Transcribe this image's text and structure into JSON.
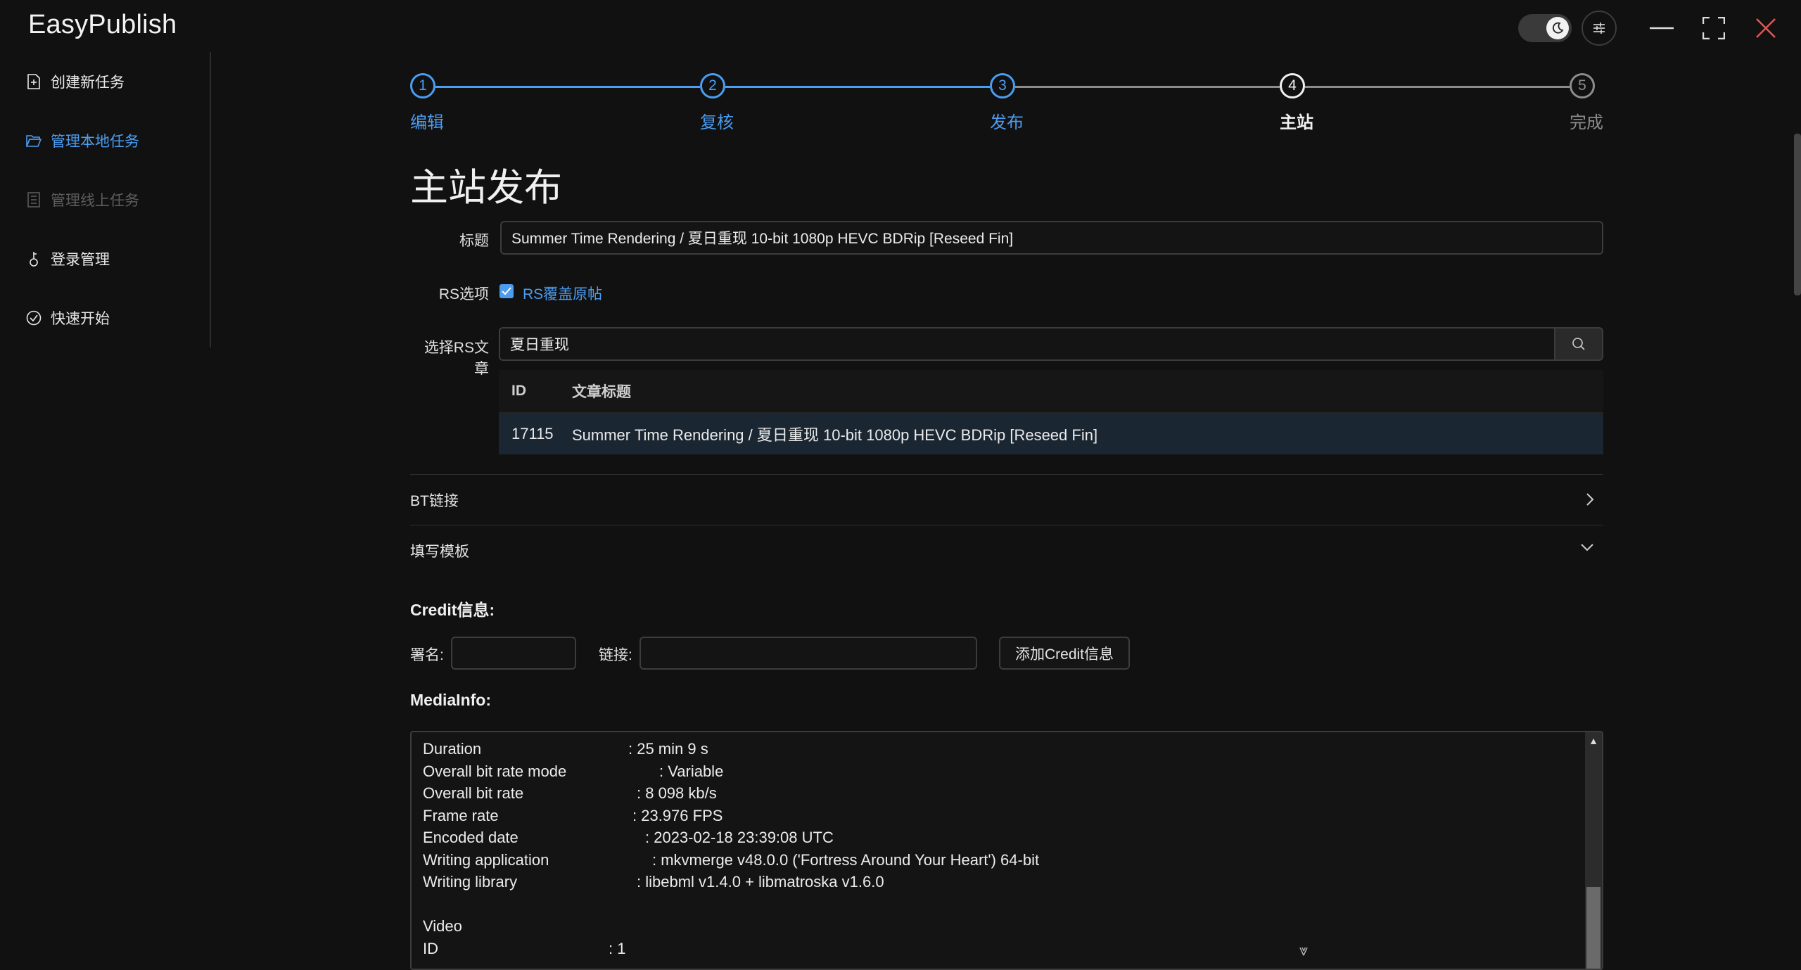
{
  "app": {
    "title": "EasyPublish"
  },
  "sidebar": {
    "items": [
      {
        "label": "创建新任务"
      },
      {
        "label": "管理本地任务"
      },
      {
        "label": "管理线上任务"
      },
      {
        "label": "登录管理"
      },
      {
        "label": "快速开始"
      }
    ]
  },
  "steps": [
    {
      "num": "1",
      "label": "编辑"
    },
    {
      "num": "2",
      "label": "复核"
    },
    {
      "num": "3",
      "label": "发布"
    },
    {
      "num": "4",
      "label": "主站"
    },
    {
      "num": "5",
      "label": "完成"
    }
  ],
  "page": {
    "title": "主站发布"
  },
  "form": {
    "title_label": "标题",
    "title_value": "Summer Time Rendering / 夏日重现 10-bit 1080p HEVC BDRip [Reseed Fin]",
    "rs_label": "RS选项",
    "rs_checkbox_label": "RS覆盖原帖",
    "rs_select_label": "选择RS文章",
    "rs_search_value": "夏日重现"
  },
  "table": {
    "headers": [
      "ID",
      "文章标题"
    ],
    "rows": [
      {
        "id": "17115",
        "title": "Summer Time Rendering / 夏日重现 10-bit 1080p HEVC BDRip [Reseed Fin]"
      }
    ]
  },
  "sections": {
    "bt_link": "BT链接",
    "template": "填写模板",
    "credit_heading": "Credit信息:",
    "signature_label": "署名:",
    "link_label": "链接:",
    "add_credit_button": "添加Credit信息",
    "mediainfo_heading": "MediaInfo:"
  },
  "mediainfo": {
    "lines": [
      {
        "key": "Duration",
        "value": ": 25 min 9 s"
      },
      {
        "key": "Overall bit rate mode",
        "value": ": Variable"
      },
      {
        "key": "Overall bit rate",
        "value": ": 8 098 kb/s"
      },
      {
        "key": "Frame rate",
        "value": ": 23.976 FPS"
      },
      {
        "key": "Encoded date",
        "value": ": 2023-02-18 23:39:08 UTC"
      },
      {
        "key": "Writing application",
        "value": ": mkvmerge v48.0.0 ('Fortress Around Your Heart') 64-bit"
      },
      {
        "key": "Writing library",
        "value": ": libebml v1.4.0 + libmatroska v1.6.0"
      },
      {
        "key": "",
        "value": ""
      },
      {
        "key": "Video",
        "value": ""
      },
      {
        "key": "ID",
        "value": ": 1"
      }
    ]
  },
  "colors": {
    "accent": "#4c9cf0",
    "background": "#111111",
    "selected_row": "#1a2632"
  }
}
